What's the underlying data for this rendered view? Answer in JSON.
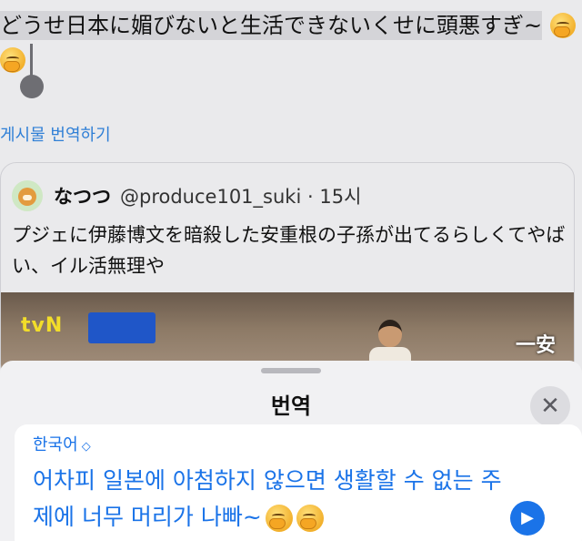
{
  "tweet": {
    "text": "どうせ日本に媚びないと生活できないくせに頭悪すぎ~",
    "translate_link": "게시물 번역하기"
  },
  "quote": {
    "author_name": "なつつ",
    "handle": "@produce101_suki",
    "separator": "·",
    "time": "15시",
    "body": "プジェに伊藤博文を暗殺した安重根の子孫が出てるらしくてやばい、イル活無理や",
    "media": {
      "logo": "tvN",
      "caption": "一安"
    }
  },
  "sheet": {
    "title": "번역",
    "close_symbol": "✕",
    "language": "한국어",
    "language_chevron": "◇",
    "translation": "어차피 일본에 아첨하지 않으면 생활할 수 없는 주제에 너무 머리가 나빠~",
    "play_symbol": "▶"
  },
  "colors": {
    "accent": "#1a73e8",
    "link": "#2f7fd6",
    "background": "#eaeaec",
    "sheet": "#f1f1f3"
  }
}
